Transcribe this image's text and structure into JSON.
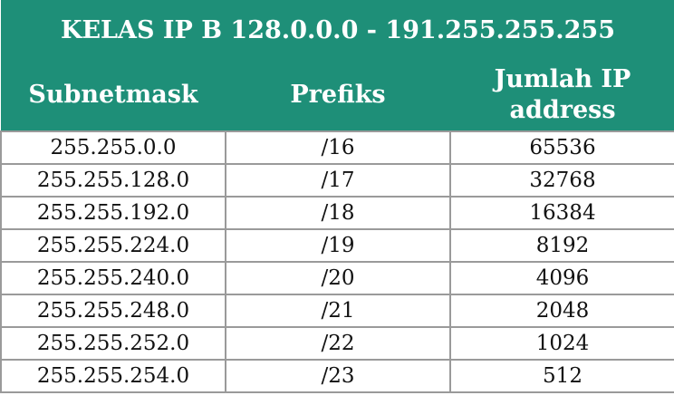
{
  "table": {
    "title": "KELAS IP B 128.0.0.0 - 191.255.255.255",
    "headers": {
      "subnetmask": "Subnetmask",
      "prefiks": "Prefiks",
      "jumlah_line1": "Jumlah IP",
      "jumlah_line2": "address"
    },
    "rows": [
      {
        "subnetmask": "255.255.0.0",
        "prefiks": "/16",
        "jumlah": "65536"
      },
      {
        "subnetmask": "255.255.128.0",
        "prefiks": "/17",
        "jumlah": "32768"
      },
      {
        "subnetmask": "255.255.192.0",
        "prefiks": "/18",
        "jumlah": "16384"
      },
      {
        "subnetmask": "255.255.224.0",
        "prefiks": "/19",
        "jumlah": "8192"
      },
      {
        "subnetmask": "255.255.240.0",
        "prefiks": "/20",
        "jumlah": "4096"
      },
      {
        "subnetmask": "255.255.248.0",
        "prefiks": "/21",
        "jumlah": "2048"
      },
      {
        "subnetmask": "255.255.252.0",
        "prefiks": "/22",
        "jumlah": "1024"
      },
      {
        "subnetmask": "255.255.254.0",
        "prefiks": "/23",
        "jumlah": "512"
      }
    ]
  },
  "colors": {
    "header_bg": "#1e8f78",
    "header_text": "#ffffff",
    "border": "#9a9a9a"
  }
}
